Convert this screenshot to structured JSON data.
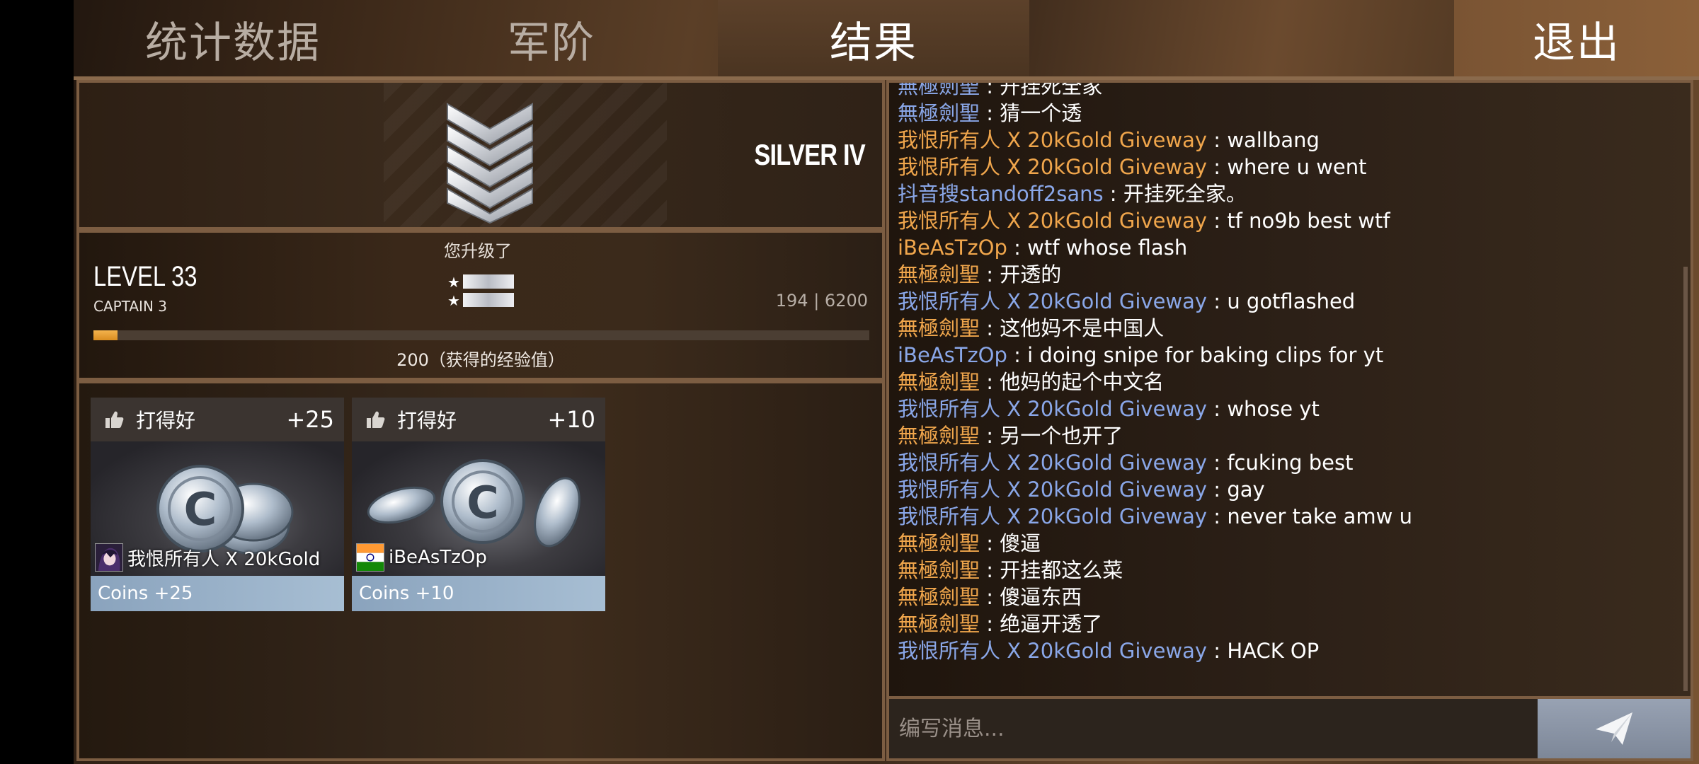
{
  "tabs": {
    "stats": "统计数据",
    "rank": "军阶",
    "result": "结果",
    "exit": "退出"
  },
  "rank": {
    "name": "SILVER IV",
    "icon": "silver-chevron-rank-icon"
  },
  "level": {
    "level_up_text": "您升级了",
    "title": "LEVEL 33",
    "subtitle": "CAPTAIN 3",
    "xp_progress": "194 | 6200",
    "xp_fraction": 0.031,
    "xp_gained": "200（获得的经验值）"
  },
  "rewards": [
    {
      "label": "打得好",
      "points": "+25",
      "player": "我恨所有人 X 20kGold",
      "footer": "Coins +25",
      "icon": "thumbs-up-icon"
    },
    {
      "label": "打得好",
      "points": "+10",
      "player": "iBeAsTzOp",
      "footer": "Coins +10",
      "icon": "thumbs-up-icon"
    }
  ],
  "chat": {
    "messages": [
      {
        "name": "無極劍聖",
        "color": "blue",
        "text": "开挂死全家"
      },
      {
        "name": "無極劍聖",
        "color": "blue",
        "text": "猜一个透"
      },
      {
        "name": "我恨所有人 X 20kGold Giveway",
        "color": "orange",
        "text": "wallbang"
      },
      {
        "name": "我恨所有人 X 20kGold Giveway",
        "color": "orange",
        "text": "where u went"
      },
      {
        "name": "抖音搜standoff2sans",
        "color": "blue",
        "text": "开挂死全家。"
      },
      {
        "name": "我恨所有人 X 20kGold Giveway",
        "color": "orange",
        "text": "tf no9b best wtf"
      },
      {
        "name": "iBeAsTzOp",
        "color": "orange",
        "text": "wtf whose flash"
      },
      {
        "name": "無極劍聖",
        "color": "orange",
        "text": "开透的"
      },
      {
        "name": "我恨所有人 X 20kGold Giveway",
        "color": "blue",
        "text": "u gotflashed"
      },
      {
        "name": "無極劍聖",
        "color": "orange",
        "text": "这他妈不是中国人"
      },
      {
        "name": "iBeAsTzOp",
        "color": "blue",
        "text": "i doing snipe for baking clips for yt"
      },
      {
        "name": "無極劍聖",
        "color": "orange",
        "text": "他妈的起个中文名"
      },
      {
        "name": "我恨所有人 X 20kGold Giveway",
        "color": "blue",
        "text": "whose yt"
      },
      {
        "name": "無極劍聖",
        "color": "orange",
        "text": "另一个也开了"
      },
      {
        "name": "我恨所有人 X 20kGold Giveway",
        "color": "blue",
        "text": "fcuking best"
      },
      {
        "name": "我恨所有人 X 20kGold Giveway",
        "color": "blue",
        "text": "gay"
      },
      {
        "name": "我恨所有人 X 20kGold Giveway",
        "color": "blue",
        "text": "never take amw u"
      },
      {
        "name": "無極劍聖",
        "color": "orange",
        "text": "傻逼"
      },
      {
        "name": "無極劍聖",
        "color": "orange",
        "text": "开挂都这么菜"
      },
      {
        "name": "無極劍聖",
        "color": "orange",
        "text": "傻逼东西"
      },
      {
        "name": "無極劍聖",
        "color": "orange",
        "text": "绝逼开透了"
      },
      {
        "name": "我恨所有人 X 20kGold Giveway",
        "color": "blue",
        "text": "HACK OP"
      }
    ],
    "input_placeholder": "编写消息...",
    "send_icon": "paper-plane-send-icon"
  },
  "colors": {
    "orange_name": "#f0a64c",
    "blue_name": "#8aa7e8",
    "xp_fill": "#e9a232",
    "coins_footer": "#98b1c9"
  }
}
